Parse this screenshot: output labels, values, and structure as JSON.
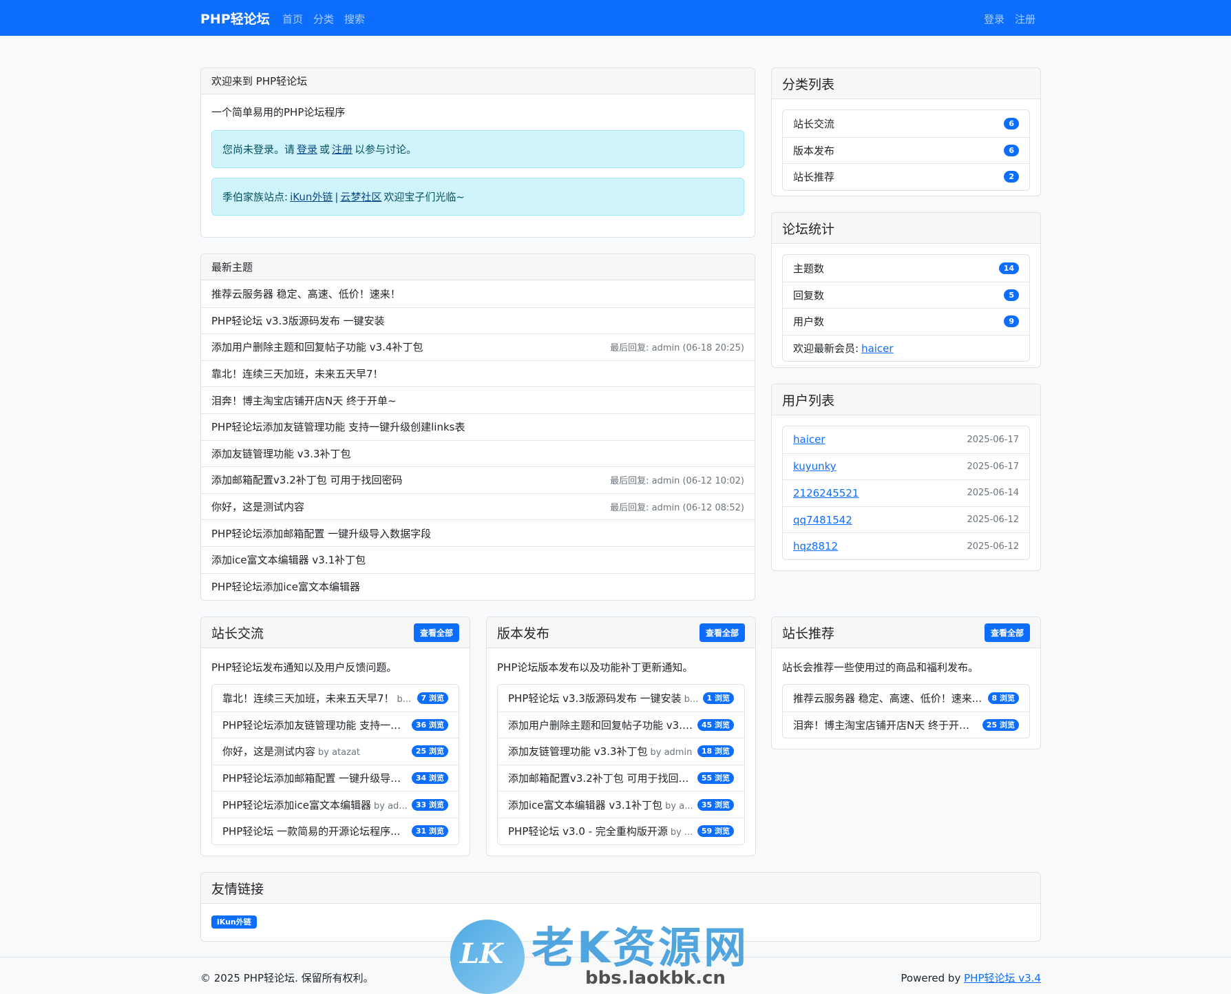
{
  "nav": {
    "brand": "PHP轻论坛",
    "links": [
      "首页",
      "分类",
      "搜索"
    ],
    "login": "登录",
    "register": "注册"
  },
  "welcome": {
    "title": "欢迎来到 PHP轻论坛",
    "desc": "一个简单易用的PHP论坛程序",
    "alert1_prefix": "您尚未登录。请",
    "alert1_login": "登录",
    "alert1_or": "或",
    "alert1_register": "注册",
    "alert1_suffix": "以参与讨论。",
    "alert2_prefix": "季伯家族站点:",
    "alert2_link1": "iKun外链",
    "alert2_sep": "|",
    "alert2_link2": "云梦社区",
    "alert2_suffix": "欢迎宝子们光临~"
  },
  "latest": {
    "title": "最新主题",
    "topics": [
      {
        "title": "推荐云服务器 稳定、高速、低价！速来！",
        "meta": ""
      },
      {
        "title": "PHP轻论坛 v3.3版源码发布 一键安装",
        "meta": ""
      },
      {
        "title": "添加用户删除主题和回复帖子功能 v3.4补丁包",
        "meta": "最后回复: admin (06-18 20:25)"
      },
      {
        "title": "靠北！连续三天加班，未来五天早7！",
        "meta": ""
      },
      {
        "title": "泪奔！博主淘宝店铺开店N天 终于开单~",
        "meta": ""
      },
      {
        "title": "PHP轻论坛添加友链管理功能 支持一键升级创建links表",
        "meta": ""
      },
      {
        "title": "添加友链管理功能 v3.3补丁包",
        "meta": ""
      },
      {
        "title": "添加邮箱配置v3.2补丁包 可用于找回密码",
        "meta": "最后回复: admin (06-12 10:02)"
      },
      {
        "title": "你好，这是测试内容",
        "meta": "最后回复: admin (06-12 08:52)"
      },
      {
        "title": "PHP轻论坛添加邮箱配置 一键升级导入数据字段",
        "meta": ""
      },
      {
        "title": "添加ice富文本编辑器 v3.1补丁包",
        "meta": ""
      },
      {
        "title": "PHP轻论坛添加ice富文本编辑器",
        "meta": ""
      }
    ]
  },
  "categories": {
    "title": "分类列表",
    "items": [
      {
        "name": "站长交流",
        "count": "6"
      },
      {
        "name": "版本发布",
        "count": "6"
      },
      {
        "name": "站长推荐",
        "count": "2"
      }
    ]
  },
  "stats": {
    "title": "论坛统计",
    "items": [
      {
        "name": "主题数",
        "count": "14"
      },
      {
        "name": "回复数",
        "count": "5"
      },
      {
        "name": "用户数",
        "count": "9"
      }
    ],
    "newest_label": "欢迎最新会员:",
    "newest_user": "haicer"
  },
  "users": {
    "title": "用户列表",
    "items": [
      {
        "name": "haicer",
        "date": "2025-06-17"
      },
      {
        "name": "kuyunky",
        "date": "2025-06-17"
      },
      {
        "name": "2126245521",
        "date": "2025-06-14"
      },
      {
        "name": "qq7481542",
        "date": "2025-06-12"
      },
      {
        "name": "hqz8812",
        "date": "2025-06-12"
      }
    ]
  },
  "sections": [
    {
      "title": "站长交流",
      "button": "查看全部",
      "desc": "PHP轻论坛发布通知以及用户反馈问题。",
      "topics": [
        {
          "title": "靠北！连续三天加班，未来五天早7！",
          "by": "b...",
          "views": "7 浏览"
        },
        {
          "title": "PHP轻论坛添加友链管理功能 支持一键...",
          "by": "",
          "views": "36 浏览"
        },
        {
          "title": "你好，这是测试内容",
          "by": "by atazat",
          "views": "25 浏览"
        },
        {
          "title": "PHP轻论坛添加邮箱配置 一键升级导入...",
          "by": "",
          "views": "34 浏览"
        },
        {
          "title": "PHP轻论坛添加ice富文本编辑器",
          "by": "by ad...",
          "views": "33 浏览"
        },
        {
          "title": "PHP轻论坛 一款简易的开源论坛程序...",
          "by": "",
          "views": "31 浏览"
        }
      ]
    },
    {
      "title": "版本发布",
      "button": "查看全部",
      "desc": "PHP论坛版本发布以及功能补丁更新通知。",
      "topics": [
        {
          "title": "PHP轻论坛 v3.3版源码发布 一键安装",
          "by": "b...",
          "views": "1 浏览"
        },
        {
          "title": "添加用户删除主题和回复帖子功能 v3.4...",
          "by": "",
          "views": "45 浏览"
        },
        {
          "title": "添加友链管理功能 v3.3补丁包",
          "by": "by admin",
          "views": "18 浏览"
        },
        {
          "title": "添加邮箱配置v3.2补丁包 可用于找回密...",
          "by": "",
          "views": "55 浏览"
        },
        {
          "title": "添加ice富文本编辑器 v3.1补丁包",
          "by": "by a...",
          "views": "35 浏览"
        },
        {
          "title": "PHP轻论坛 v3.0 - 完全重构版开源",
          "by": "by ...",
          "views": "59 浏览"
        }
      ]
    },
    {
      "title": "站长推荐",
      "button": "查看全部",
      "desc": "站长会推荐一些使用过的商品和福利发布。",
      "topics": [
        {
          "title": "推荐云服务器 稳定、高速、低价！速来...",
          "by": "",
          "views": "8 浏览"
        },
        {
          "title": "泪奔！博主淘宝店铺开店N天 终于开单...",
          "by": "",
          "views": "25 浏览"
        }
      ]
    }
  ],
  "friends": {
    "title": "友情链接",
    "links": [
      "iKun外链"
    ]
  },
  "footer": {
    "copyright": "© 2025 PHP轻论坛. 保留所有权利。",
    "powered_prefix": "Powered by",
    "powered_link": "PHP轻论坛 v3.4"
  },
  "watermark": {
    "logo_text": "LK",
    "title": "老K资源网",
    "url": "bbs.laokbk.cn"
  }
}
